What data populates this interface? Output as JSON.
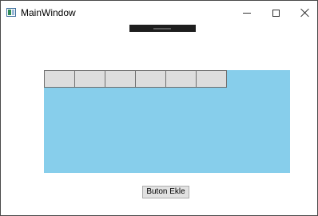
{
  "window": {
    "title": "MainWindow"
  },
  "controls": {
    "minimize_icon": "minimize-icon",
    "maximize_icon": "maximize-icon",
    "close_icon": "close-icon"
  },
  "panel": {
    "background": "#87ceeb",
    "button_count": 6
  },
  "add_button": {
    "label": "Buton Ekle"
  }
}
